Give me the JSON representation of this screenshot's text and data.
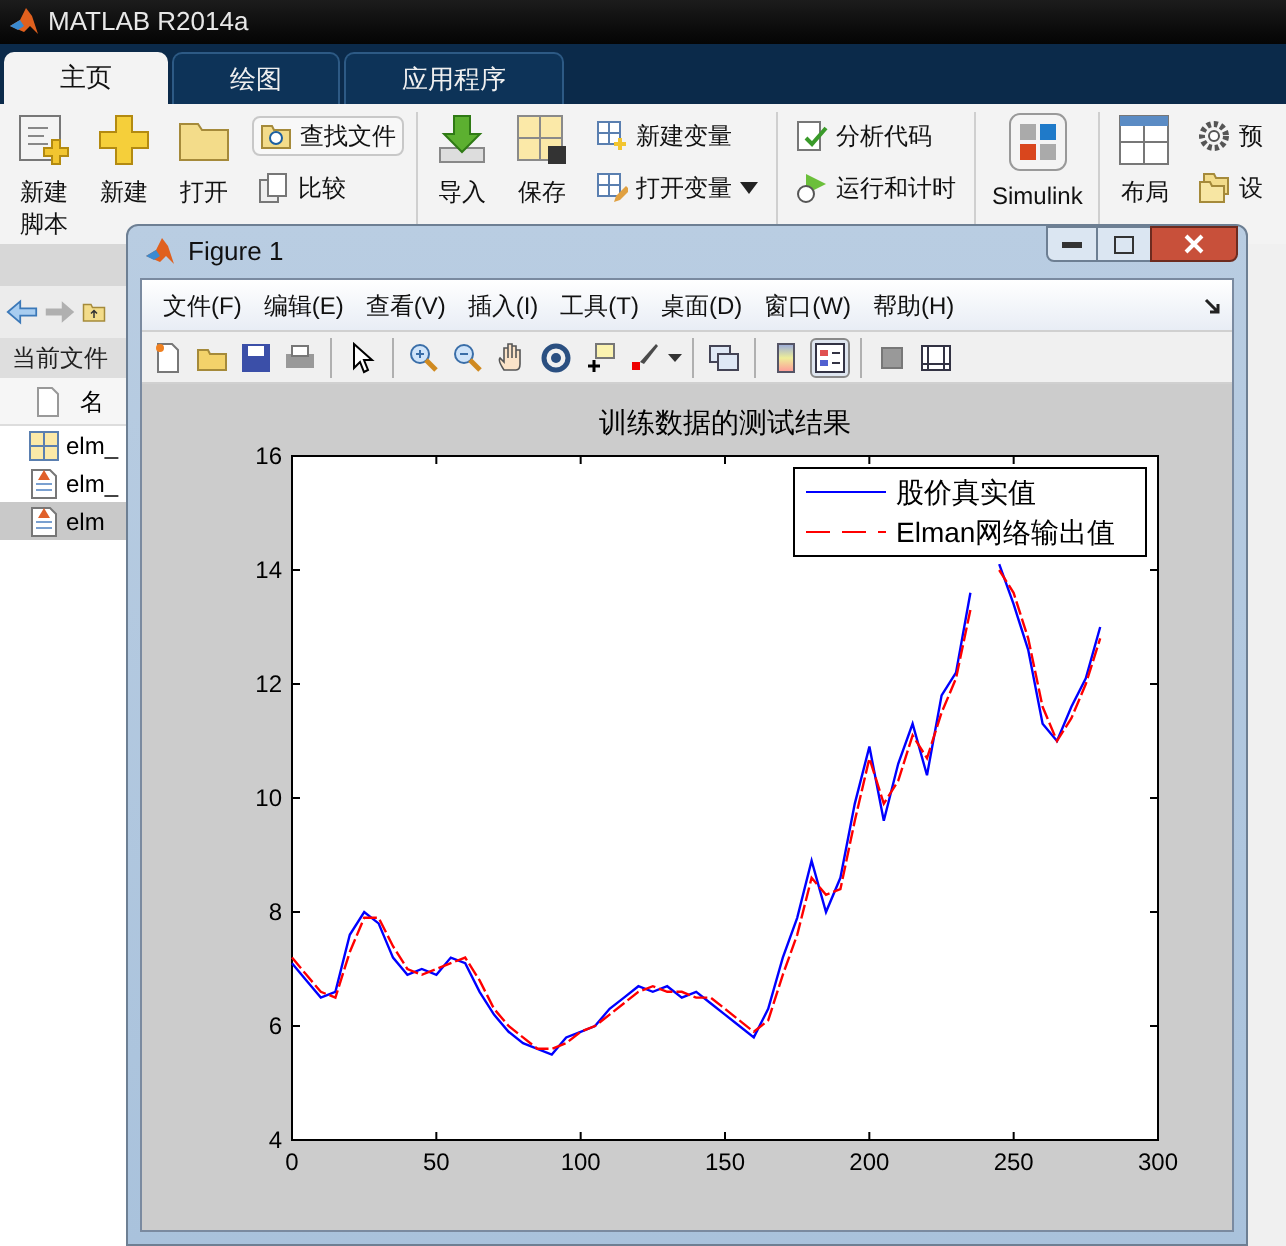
{
  "app": {
    "title": "MATLAB R2014a"
  },
  "tabs": [
    {
      "label": "主页",
      "selected": true
    },
    {
      "label": "绘图",
      "selected": false
    },
    {
      "label": "应用程序",
      "selected": false
    }
  ],
  "ribbon": {
    "sections": [
      {
        "large": [
          "新建脚本",
          "新建",
          "打开"
        ],
        "small": [
          {
            "label": "查找文件",
            "kind": "framed"
          },
          {
            "label": "比较",
            "kind": "plain"
          }
        ]
      },
      {
        "large": [
          "导入",
          "保存"
        ],
        "small": [
          {
            "label": "新建变量",
            "kind": "plain"
          },
          {
            "label": "打开变量",
            "kind": "dropdown"
          }
        ]
      },
      {
        "small": [
          {
            "label": "分析代码",
            "kind": "plain"
          },
          {
            "label": "运行和计时",
            "kind": "plain"
          }
        ]
      },
      {
        "large": [
          "Simulink"
        ]
      },
      {
        "large": [
          "布局"
        ],
        "small": [
          {
            "label": "预",
            "kind": "plain"
          },
          {
            "label": "设",
            "kind": "plain"
          }
        ]
      }
    ]
  },
  "current_folder": {
    "title": "当前文件",
    "column": "名",
    "files": [
      {
        "name": "elm_",
        "kind": "layout",
        "selected": false
      },
      {
        "name": "elm_",
        "kind": "mfile",
        "selected": false
      },
      {
        "name": "elm",
        "kind": "mfile",
        "selected": true
      }
    ]
  },
  "figure": {
    "title": "Figure 1",
    "menu": [
      "文件(F)",
      "编辑(E)",
      "查看(V)",
      "插入(I)",
      "工具(T)",
      "桌面(D)",
      "窗口(W)",
      "帮助(H)"
    ],
    "toolbar": {
      "legend_pressed": true
    },
    "chart_data": {
      "type": "line",
      "title": "训练数据的测试结果",
      "x": [
        0,
        5,
        10,
        15,
        20,
        25,
        30,
        35,
        40,
        45,
        50,
        55,
        60,
        65,
        70,
        75,
        80,
        85,
        90,
        95,
        100,
        105,
        110,
        115,
        120,
        125,
        130,
        135,
        140,
        145,
        150,
        155,
        160,
        165,
        170,
        175,
        180,
        185,
        190,
        195,
        200,
        205,
        210,
        215,
        220,
        225,
        230,
        235,
        240,
        245,
        250,
        255,
        260,
        265,
        270,
        275,
        280
      ],
      "series": [
        {
          "name": "股价真实值",
          "color": "#0000ff",
          "line_style": "solid",
          "values": [
            7.1,
            6.8,
            6.5,
            6.6,
            7.6,
            8.0,
            7.8,
            7.2,
            6.9,
            7.0,
            6.9,
            7.2,
            7.1,
            6.6,
            6.2,
            5.9,
            5.7,
            5.6,
            5.5,
            5.8,
            5.9,
            6.0,
            6.3,
            6.5,
            6.7,
            6.6,
            6.7,
            6.5,
            6.6,
            6.4,
            6.2,
            6.0,
            5.8,
            6.3,
            7.2,
            7.9,
            8.9,
            8.0,
            8.6,
            9.9,
            10.9,
            9.6,
            10.6,
            11.3,
            10.4,
            11.8,
            12.2,
            13.6,
            null,
            14.1,
            13.4,
            12.6,
            11.3,
            11.0,
            11.6,
            12.1,
            13.0
          ]
        },
        {
          "name": "Elman网络输出值",
          "color": "#ff0000",
          "line_style": "dashed",
          "values": [
            7.2,
            6.9,
            6.6,
            6.5,
            7.3,
            7.9,
            7.9,
            7.4,
            7.0,
            6.9,
            7.0,
            7.1,
            7.2,
            6.8,
            6.3,
            6.0,
            5.8,
            5.6,
            5.6,
            5.7,
            5.9,
            6.0,
            6.2,
            6.4,
            6.6,
            6.7,
            6.6,
            6.6,
            6.5,
            6.5,
            6.3,
            6.1,
            5.9,
            6.1,
            6.9,
            7.6,
            8.6,
            8.3,
            8.4,
            9.6,
            10.7,
            9.9,
            10.3,
            11.1,
            10.7,
            11.5,
            12.1,
            13.3,
            null,
            14.0,
            13.6,
            12.8,
            11.6,
            11.0,
            11.4,
            12.0,
            12.8
          ]
        }
      ],
      "legend": true,
      "xlim": [
        0,
        300
      ],
      "ylim": [
        4,
        16
      ],
      "xticks": [
        0,
        50,
        100,
        150,
        200,
        250,
        300
      ],
      "yticks": [
        4,
        6,
        8,
        10,
        12,
        14,
        16
      ]
    }
  }
}
